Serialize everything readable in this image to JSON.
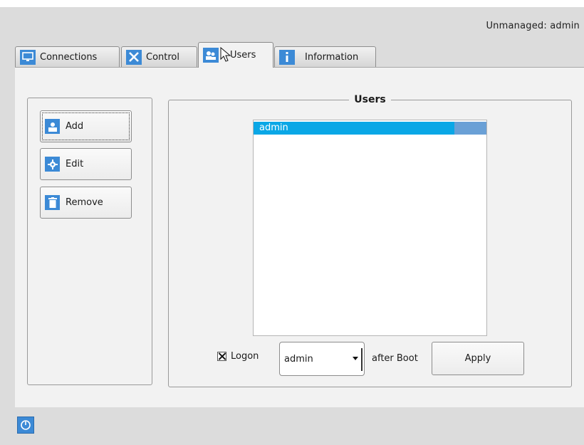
{
  "status_text": "Unmanaged: admin",
  "tabs": [
    {
      "label": "Connections",
      "icon": "monitor-icon"
    },
    {
      "label": "Control",
      "icon": "tools-icon"
    },
    {
      "label": "Users",
      "icon": "users-icon"
    },
    {
      "label": "Information",
      "icon": "info-icon"
    }
  ],
  "active_tab": "Users",
  "actions": {
    "add": "Add",
    "edit": "Edit",
    "remove": "Remove"
  },
  "users_group": {
    "title": "Users",
    "list": [
      "admin"
    ],
    "selected": "admin"
  },
  "logon": {
    "checked": true,
    "label": "Logon",
    "selected_user": "admin",
    "suffix": "after Boot",
    "apply": "Apply"
  },
  "colors": {
    "accent": "#3c8ad6",
    "selection": "#0aa7e6"
  }
}
